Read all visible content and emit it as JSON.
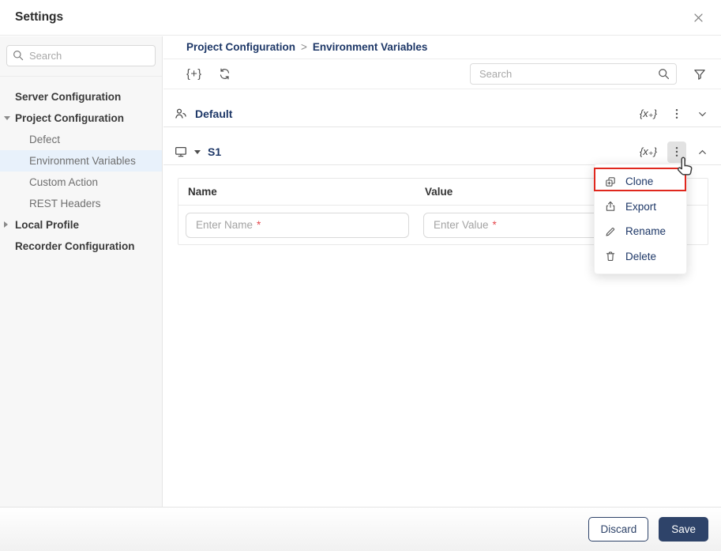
{
  "window": {
    "title": "Settings"
  },
  "sidebar": {
    "search": {
      "placeholder": "Search"
    },
    "selected_item": "Environment Variables",
    "items": [
      {
        "label": "Server Configuration"
      },
      {
        "label": "Project Configuration"
      },
      {
        "label": "Defect"
      },
      {
        "label": "Environment Variables"
      },
      {
        "label": "Custom Action"
      },
      {
        "label": "REST Headers"
      },
      {
        "label": "Local Profile"
      },
      {
        "label": "Recorder Configuration"
      }
    ]
  },
  "breadcrumb": {
    "parent": "Project Configuration",
    "separator": ">",
    "current": "Environment Variables"
  },
  "toolbar": {
    "add_variable_label": "{+}",
    "search": {
      "placeholder": "Search"
    }
  },
  "sections": {
    "default": {
      "title": "Default",
      "insert_variable_label": "{x₊}"
    },
    "s1": {
      "title": "S1",
      "insert_variable_label": "{x₊}"
    }
  },
  "variables_table": {
    "columns": {
      "name": "Name",
      "value": "Value"
    },
    "placeholders": {
      "name": "Enter Name",
      "value": "Enter Value"
    },
    "required_marker": "*"
  },
  "context_menu": {
    "items": [
      {
        "label": "Clone",
        "icon": "clone-icon",
        "annotated": true
      },
      {
        "label": "Export",
        "icon": "export-icon"
      },
      {
        "label": "Rename",
        "icon": "rename-icon"
      },
      {
        "label": "Delete",
        "icon": "delete-icon"
      }
    ]
  },
  "footer": {
    "discard_label": "Discard",
    "save_label": "Save"
  },
  "colors": {
    "navy_text": "#1d3767",
    "save_button_bg": "#2e4369",
    "selected_item_bg": "#e8f1fb",
    "annotation_red": "#e0281e",
    "required_red": "#e5484d",
    "sidebar_bg": "#f7f7f7"
  }
}
